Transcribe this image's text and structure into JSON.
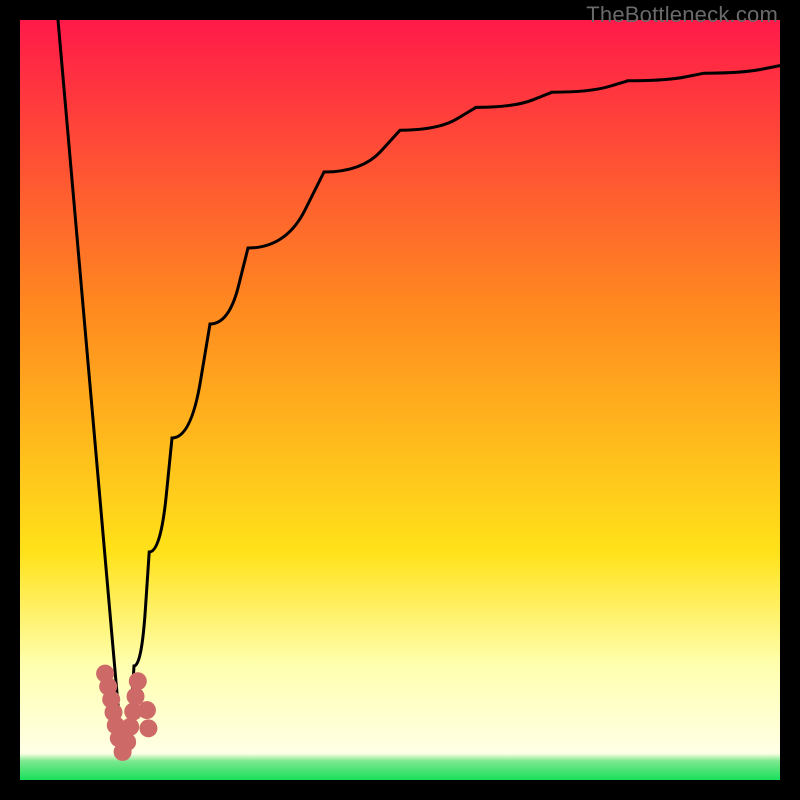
{
  "attribution": "TheBottleneck.com",
  "colors": {
    "top": "#ff1a49",
    "mid1": "#ff8a1f",
    "mid2": "#ffe21a",
    "pale": "#ffffb0",
    "green": "#18e05a",
    "frame": "#000000",
    "curve": "#000000",
    "marker": "#cd6a67"
  },
  "chart_data": {
    "type": "line",
    "title": "",
    "xlabel": "",
    "ylabel": "",
    "xlim": [
      0,
      100
    ],
    "ylim": [
      0,
      100
    ],
    "series": [
      {
        "name": "left-line",
        "x": [
          5,
          13.5
        ],
        "values": [
          100,
          3
        ]
      },
      {
        "name": "right-curve",
        "x": [
          13.5,
          15,
          17,
          20,
          25,
          30,
          40,
          50,
          60,
          70,
          80,
          90,
          100
        ],
        "values": [
          3,
          15,
          30,
          45,
          60,
          70,
          80,
          85.5,
          88.5,
          90.5,
          92,
          93,
          94
        ]
      }
    ],
    "markers": {
      "name": "bottom-cluster",
      "color": "#cd6a67",
      "points": [
        {
          "x": 11.2,
          "y": 14.0
        },
        {
          "x": 11.6,
          "y": 12.3
        },
        {
          "x": 12.0,
          "y": 10.6
        },
        {
          "x": 12.3,
          "y": 8.9
        },
        {
          "x": 12.6,
          "y": 7.2
        },
        {
          "x": 13.0,
          "y": 5.5
        },
        {
          "x": 13.5,
          "y": 3.7
        },
        {
          "x": 14.1,
          "y": 5.0
        },
        {
          "x": 14.5,
          "y": 7.0
        },
        {
          "x": 14.9,
          "y": 9.0
        },
        {
          "x": 15.2,
          "y": 11.0
        },
        {
          "x": 15.5,
          "y": 13.0
        },
        {
          "x": 16.7,
          "y": 9.2
        },
        {
          "x": 16.9,
          "y": 6.8
        }
      ]
    },
    "gradient_stops": [
      {
        "pos": 0.0,
        "color": "#ff1a49"
      },
      {
        "pos": 0.38,
        "color": "#ff8a1f"
      },
      {
        "pos": 0.7,
        "color": "#ffe21a"
      },
      {
        "pos": 0.85,
        "color": "#ffffb0"
      },
      {
        "pos": 0.965,
        "color": "#ffffe6"
      },
      {
        "pos": 0.975,
        "color": "#7de88f"
      },
      {
        "pos": 1.0,
        "color": "#18e05a"
      }
    ]
  }
}
